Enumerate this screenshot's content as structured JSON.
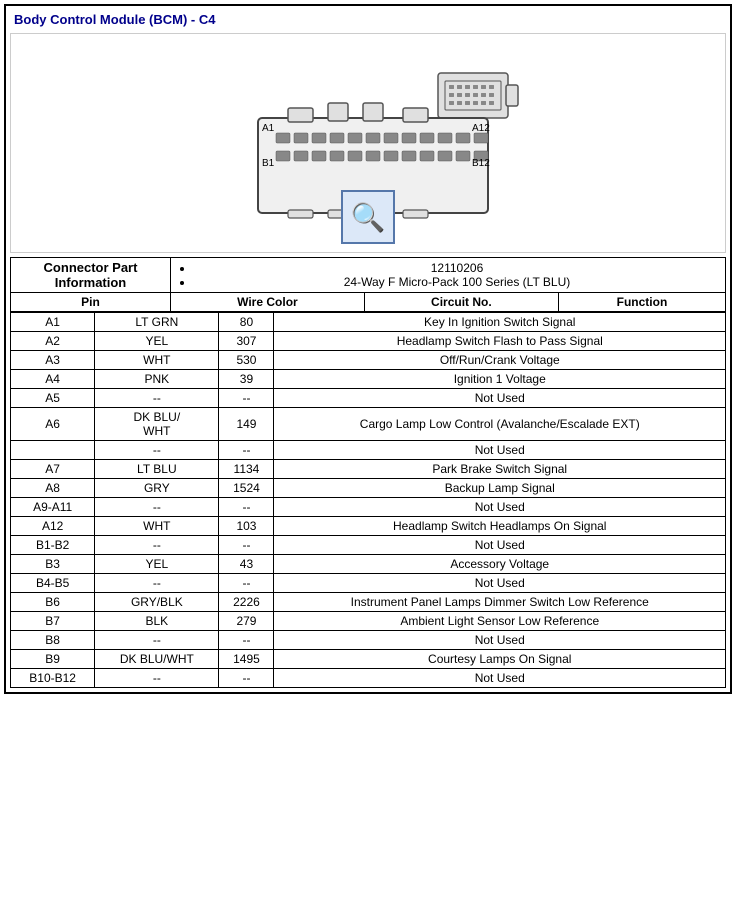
{
  "title": "Body Control Module (BCM) - C4",
  "connector_info_label": "Connector Part Information",
  "connector_details": [
    "12110206",
    "24-Way F Micro-Pack 100 Series (LT BLU)"
  ],
  "table_headers": {
    "pin": "Pin",
    "wire_color": "Wire Color",
    "circuit_no": "Circuit No.",
    "function": "Function"
  },
  "rows": [
    {
      "pin": "A1",
      "wire_color": "LT GRN",
      "circuit": "80",
      "function": "Key In Ignition Switch Signal"
    },
    {
      "pin": "A2",
      "wire_color": "YEL",
      "circuit": "307",
      "function": "Headlamp Switch Flash to Pass Signal"
    },
    {
      "pin": "A3",
      "wire_color": "WHT",
      "circuit": "530",
      "function": "Off/Run/Crank Voltage"
    },
    {
      "pin": "A4",
      "wire_color": "PNK",
      "circuit": "39",
      "function": "Ignition 1 Voltage"
    },
    {
      "pin": "A5",
      "wire_color": "--",
      "circuit": "--",
      "function": "Not Used"
    },
    {
      "pin": "A6",
      "wire_color": "DK BLU/\nWHT",
      "circuit": "149",
      "function": "Cargo Lamp Low Control (Avalanche/Escalade EXT)"
    },
    {
      "pin": "",
      "wire_color": "--",
      "circuit": "--",
      "function": "Not Used"
    },
    {
      "pin": "A7",
      "wire_color": "LT BLU",
      "circuit": "1134",
      "function": "Park Brake Switch Signal"
    },
    {
      "pin": "A8",
      "wire_color": "GRY",
      "circuit": "1524",
      "function": "Backup Lamp Signal"
    },
    {
      "pin": "A9-A11",
      "wire_color": "--",
      "circuit": "--",
      "function": "Not Used"
    },
    {
      "pin": "A12",
      "wire_color": "WHT",
      "circuit": "103",
      "function": "Headlamp Switch Headlamps On Signal"
    },
    {
      "pin": "B1-B2",
      "wire_color": "--",
      "circuit": "--",
      "function": "Not Used"
    },
    {
      "pin": "B3",
      "wire_color": "YEL",
      "circuit": "43",
      "function": "Accessory Voltage"
    },
    {
      "pin": "B4-B5",
      "wire_color": "--",
      "circuit": "--",
      "function": "Not Used"
    },
    {
      "pin": "B6",
      "wire_color": "GRY/BLK",
      "circuit": "2226",
      "function": "Instrument Panel Lamps Dimmer Switch Low Reference"
    },
    {
      "pin": "B7",
      "wire_color": "BLK",
      "circuit": "279",
      "function": "Ambient Light Sensor Low Reference"
    },
    {
      "pin": "B8",
      "wire_color": "--",
      "circuit": "--",
      "function": "Not Used"
    },
    {
      "pin": "B9",
      "wire_color": "DK BLU/WHT",
      "circuit": "1495",
      "function": "Courtesy Lamps On Signal"
    },
    {
      "pin": "B10-B12",
      "wire_color": "--",
      "circuit": "--",
      "function": "Not Used"
    }
  ],
  "magnify_symbol": "🔍"
}
